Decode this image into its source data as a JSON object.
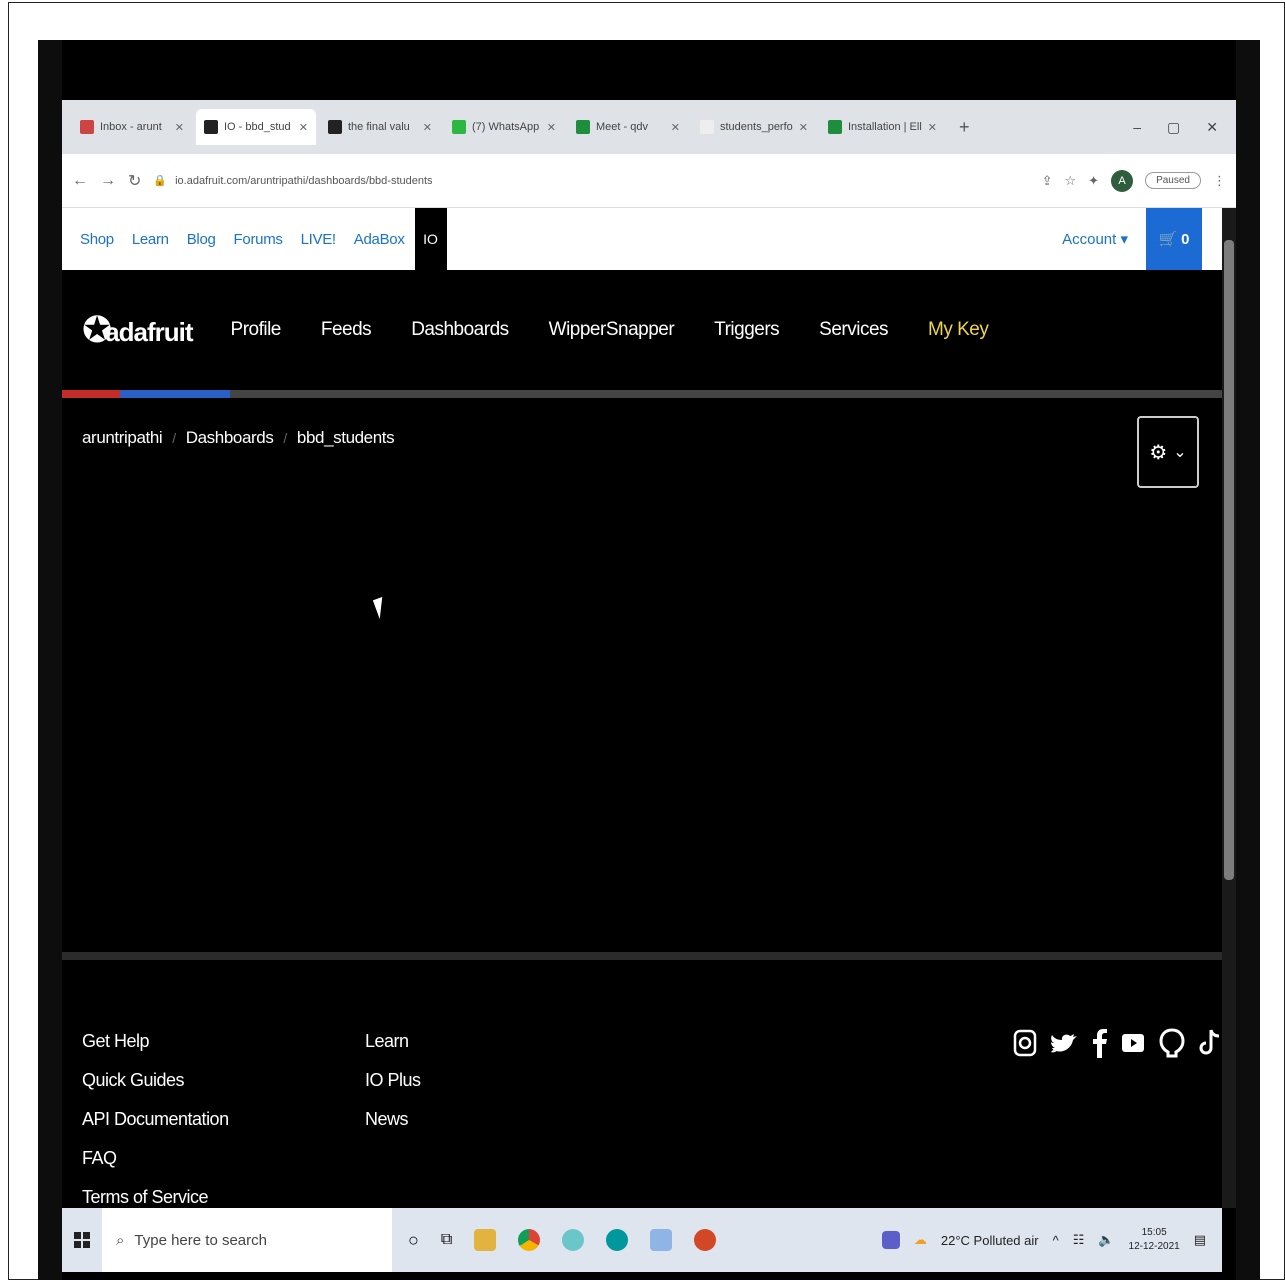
{
  "browser": {
    "tabs": [
      {
        "label": "Inbox - arunt",
        "color": "#c44"
      },
      {
        "label": "IO - bbd_stud",
        "color": "#222",
        "active": true
      },
      {
        "label": "the final valu",
        "color": "#222"
      },
      {
        "label": "(7) WhatsApp",
        "color": "#2cb742"
      },
      {
        "label": "Meet - qdv",
        "color": "#1e8e3e"
      },
      {
        "label": "students_perfo",
        "color": "#eee"
      },
      {
        "label": "Installation | Ell",
        "color": "#1e8e3e"
      }
    ],
    "new_tab": "+",
    "url": "io.adafruit.com/aruntripathi/dashboards/bbd-students",
    "profile_initial": "A",
    "profile_status": "Paused"
  },
  "toplinks": {
    "items": [
      "Shop",
      "Learn",
      "Blog",
      "Forums",
      "LIVE!",
      "AdaBox"
    ],
    "io": "IO",
    "account": "Account ▾",
    "cart": "0"
  },
  "nav": {
    "logo": "adafruit",
    "items": [
      "Profile",
      "Feeds",
      "Dashboards",
      "WipperSnapper",
      "Triggers",
      "Services"
    ],
    "my_key": "My Key"
  },
  "breadcrumb": {
    "user": "aruntripathi",
    "section": "Dashboards",
    "current": "bbd_students",
    "separator": "/"
  },
  "footer": {
    "col1": [
      "Get Help",
      "Quick Guides",
      "API Documentation",
      "FAQ",
      "Terms of Service"
    ],
    "col2": [
      "Learn",
      "IO Plus",
      "News"
    ]
  },
  "taskbar": {
    "search_placeholder": "Type here to search",
    "weather": "22°C  Polluted air",
    "time": "15:05",
    "date": "12-12-2021"
  }
}
